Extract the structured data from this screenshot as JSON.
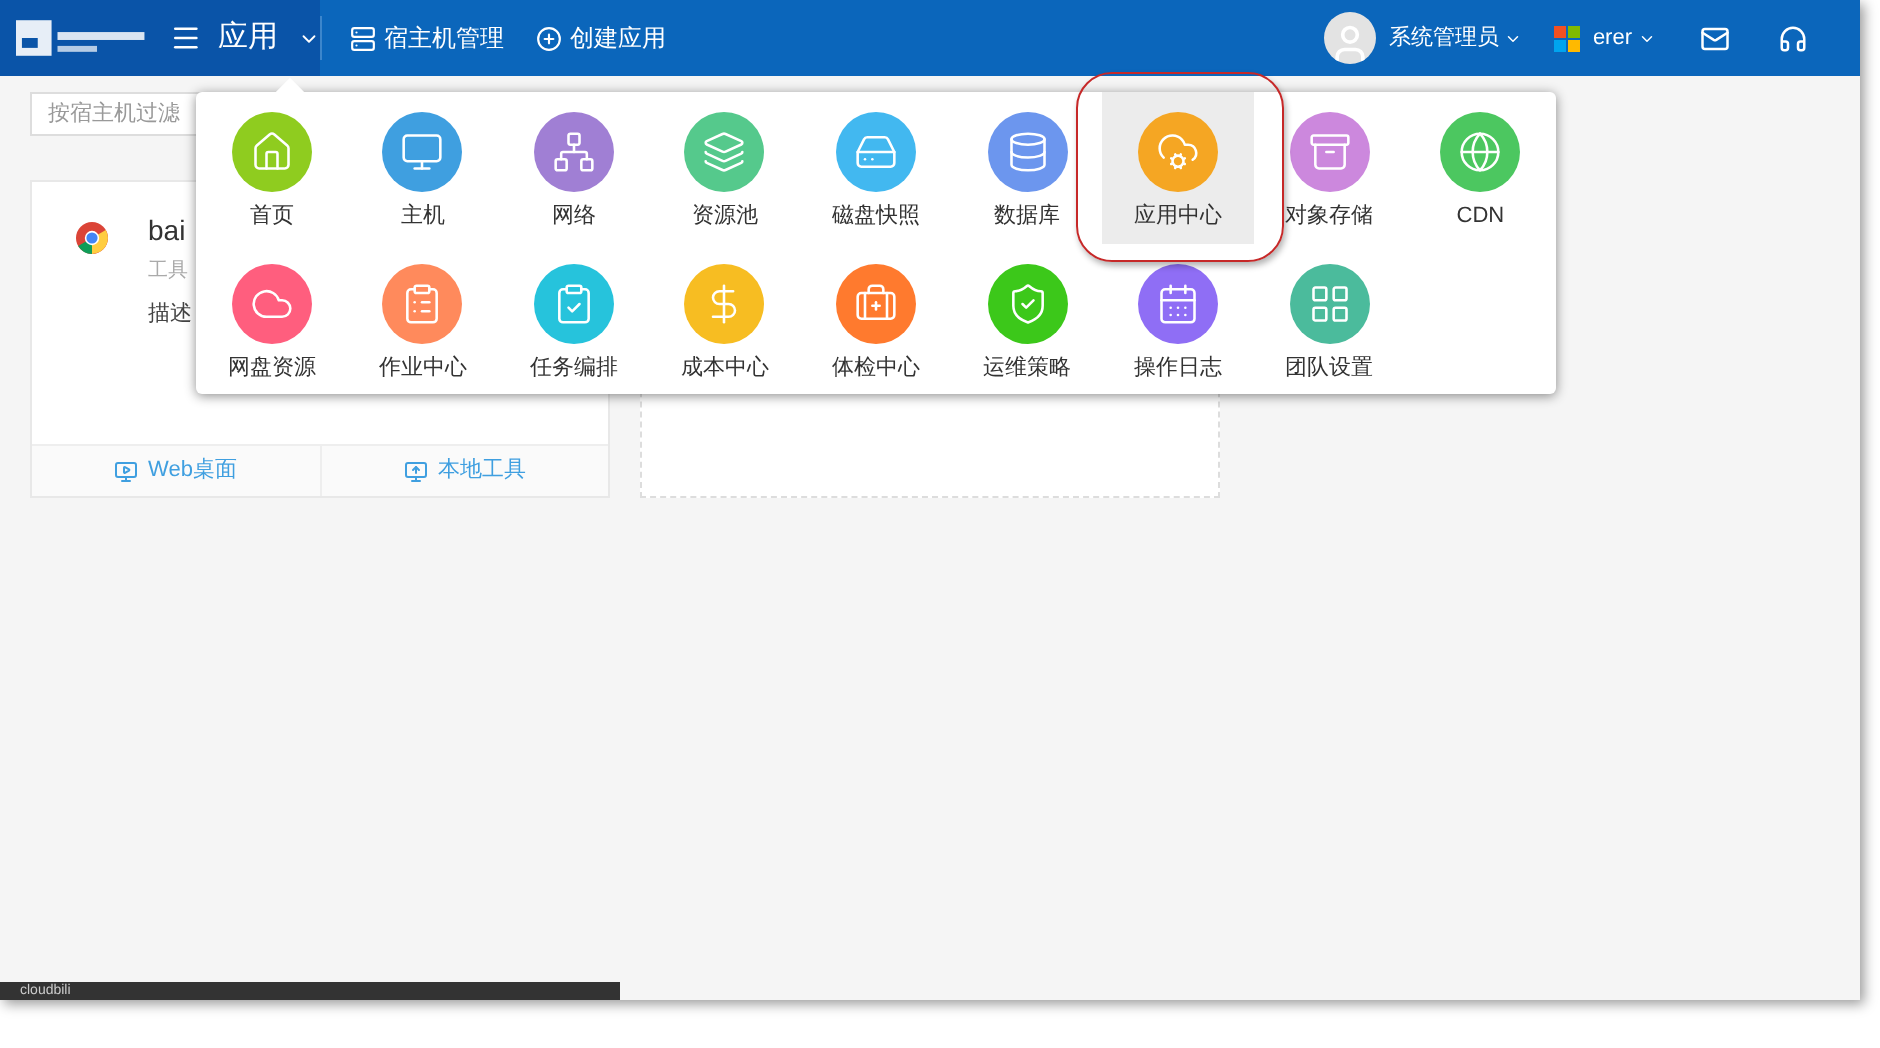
{
  "header": {
    "current_app": "应用",
    "nav": [
      {
        "label": "宿主机管理"
      },
      {
        "label": "创建应用"
      }
    ],
    "user": "系统管理员",
    "team": "erer"
  },
  "filter": {
    "placeholder": "按宿主机过滤"
  },
  "app_card": {
    "name": "bai",
    "category": "工具",
    "description": "描述",
    "actions": [
      {
        "label": "Web桌面"
      },
      {
        "label": "本地工具"
      }
    ]
  },
  "menu": {
    "items": [
      {
        "label": "首页",
        "color": "#8fcc1f",
        "selected": false
      },
      {
        "label": "主机",
        "color": "#3f9fe0",
        "selected": false
      },
      {
        "label": "网络",
        "color": "#a07fd4",
        "selected": false
      },
      {
        "label": "资源池",
        "color": "#55c98c",
        "selected": false
      },
      {
        "label": "磁盘快照",
        "color": "#42b8f0",
        "selected": false
      },
      {
        "label": "数据库",
        "color": "#6c96ee",
        "selected": false
      },
      {
        "label": "应用中心",
        "color": "#f5a623",
        "selected": true
      },
      {
        "label": "对象存储",
        "color": "#cc88dd",
        "selected": false
      },
      {
        "label": "CDN",
        "color": "#4cc760",
        "selected": false
      },
      {
        "label": "网盘资源",
        "color": "#ff5e7e",
        "selected": false
      },
      {
        "label": "作业中心",
        "color": "#ff8a5c",
        "selected": false
      },
      {
        "label": "任务编排",
        "color": "#26c3dc",
        "selected": false
      },
      {
        "label": "成本中心",
        "color": "#f7bd22",
        "selected": false
      },
      {
        "label": "体检中心",
        "color": "#ff7a2e",
        "selected": false
      },
      {
        "label": "运维策略",
        "color": "#3cc81a",
        "selected": false
      },
      {
        "label": "操作日志",
        "color": "#8f6ef5",
        "selected": false
      },
      {
        "label": "团队设置",
        "color": "#4bbb9c",
        "selected": false
      }
    ]
  },
  "status_bar": {
    "text": "cloudbili"
  }
}
